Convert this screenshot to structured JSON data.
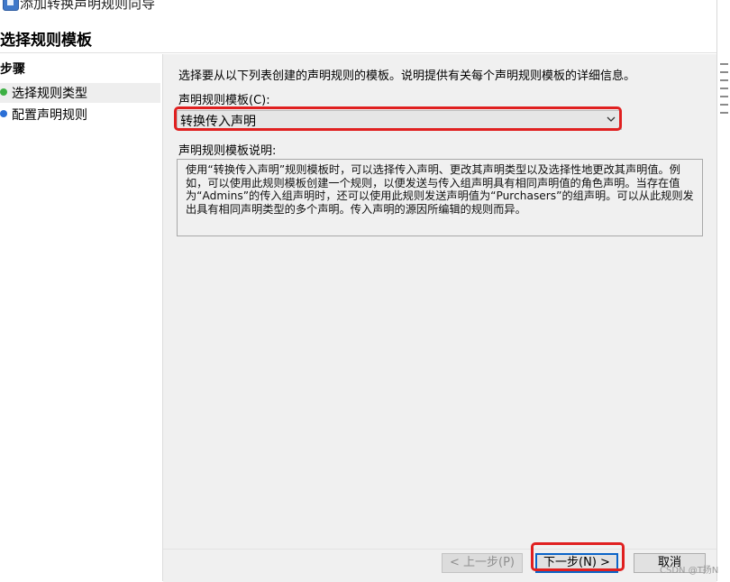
{
  "window": {
    "title": "添加转换声明规则向导"
  },
  "page_title": "选择规则模板",
  "steps": {
    "heading": "步骤",
    "items": [
      {
        "label": "选择规则类型",
        "dot_color": "#3cb043",
        "active": true
      },
      {
        "label": "配置声明规则",
        "dot_color": "#2a6fd6",
        "active": false
      }
    ]
  },
  "content": {
    "intro": "选择要从以下列表创建的声明规则的模板。说明提供有关每个声明规则模板的详细信息。",
    "template_label": "声明规则模板(C):",
    "template_value": "转换传入声明",
    "description_label": "声明规则模板说明:",
    "description_text": "使用“转换传入声明”规则模板时，可以选择传入声明、更改其声明类型以及选择性地更改其声明值。例如，可以使用此规则模板创建一个规则，以便发送与传入组声明具有相同声明值的角色声明。当存在值为“Admins”的传入组声明时，还可以使用此规则发送声明值为“Purchasers”的组声明。可以从此规则发出具有相同声明类型的多个声明。传入声明的源因所编辑的规则而异。"
  },
  "buttons": {
    "prev": "< 上一步(P)",
    "next": "下一步(N) >",
    "cancel": "取消"
  },
  "colors": {
    "highlight": "#e02020",
    "step_active": "#3cb043",
    "step_inactive": "#2a6fd6"
  },
  "watermark": "CSDN @T扬N"
}
